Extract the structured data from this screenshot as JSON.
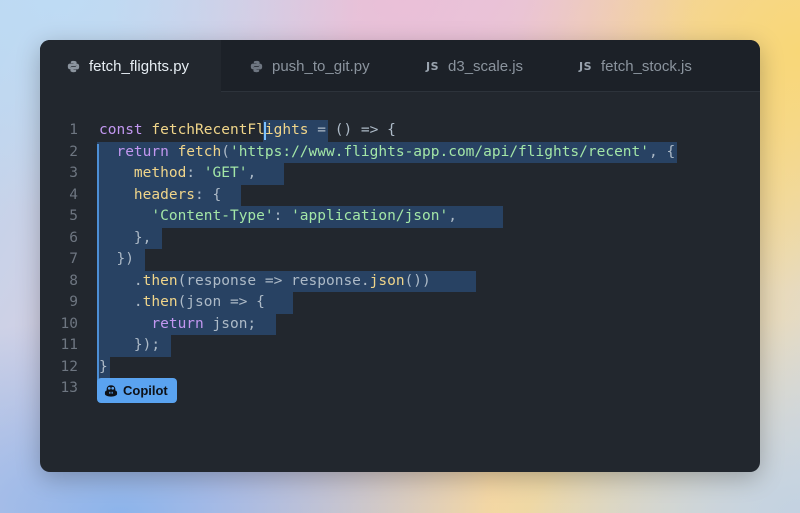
{
  "tabs": [
    {
      "label": "fetch_flights.py",
      "icon": "python-icon",
      "active": true
    },
    {
      "label": "push_to_git.py",
      "icon": "python-icon",
      "active": false
    },
    {
      "label": "d3_scale.js",
      "icon": "js-icon",
      "icon_text": "JS",
      "active": false
    },
    {
      "label": "fetch_stock.js",
      "icon": "js-icon",
      "icon_text": "JS",
      "active": false
    }
  ],
  "editor": {
    "line_numbers": [
      "1",
      "2",
      "3",
      "4",
      "5",
      "6",
      "7",
      "8",
      "9",
      "10",
      "11",
      "12",
      "13"
    ],
    "lines": [
      [
        {
          "t": "const ",
          "c": "k"
        },
        {
          "t": "fetchRecentFlights",
          "c": "f"
        },
        {
          "t": " = ",
          "c": "p"
        },
        {
          "t": "() => {",
          "c": "p"
        }
      ],
      [
        {
          "t": "  return ",
          "c": "k"
        },
        {
          "t": "fetch",
          "c": "f"
        },
        {
          "t": "(",
          "c": "p"
        },
        {
          "t": "'https://www.flights-app.com/api/flights/recent'",
          "c": "s"
        },
        {
          "t": ", {",
          "c": "p"
        }
      ],
      [
        {
          "t": "    method",
          "c": "pr"
        },
        {
          "t": ": ",
          "c": "p"
        },
        {
          "t": "'GET'",
          "c": "s"
        },
        {
          "t": ",",
          "c": "p"
        }
      ],
      [
        {
          "t": "    headers",
          "c": "pr"
        },
        {
          "t": ": {",
          "c": "p"
        }
      ],
      [
        {
          "t": "      ",
          "c": "p"
        },
        {
          "t": "'Content-Type'",
          "c": "s"
        },
        {
          "t": ": ",
          "c": "p"
        },
        {
          "t": "'application/json'",
          "c": "s"
        },
        {
          "t": ",",
          "c": "p"
        }
      ],
      [
        {
          "t": "    },",
          "c": "p"
        }
      ],
      [
        {
          "t": "  })",
          "c": "p"
        }
      ],
      [
        {
          "t": "    .",
          "c": "p"
        },
        {
          "t": "then",
          "c": "f"
        },
        {
          "t": "(response => response.",
          "c": "p"
        },
        {
          "t": "json",
          "c": "f"
        },
        {
          "t": "())",
          "c": "p"
        }
      ],
      [
        {
          "t": "    .",
          "c": "p"
        },
        {
          "t": "then",
          "c": "f"
        },
        {
          "t": "(json => {",
          "c": "p"
        }
      ],
      [
        {
          "t": "      return ",
          "c": "k"
        },
        {
          "t": "json;",
          "c": "p"
        }
      ],
      [
        {
          "t": "    });",
          "c": "p"
        }
      ],
      [
        {
          "t": "}",
          "c": "p"
        }
      ],
      []
    ],
    "highlights": [
      {
        "line": 0,
        "from": 19,
        "to": 26
      },
      {
        "line": 1,
        "from": 0,
        "to": 66
      },
      {
        "line": 2,
        "from": 0,
        "to": 21
      },
      {
        "line": 3,
        "from": 0,
        "to": 16
      },
      {
        "line": 4,
        "from": 0,
        "to": 46
      },
      {
        "line": 5,
        "from": 0,
        "to": 7
      },
      {
        "line": 6,
        "from": 0,
        "to": 5
      },
      {
        "line": 7,
        "from": 0,
        "to": 43
      },
      {
        "line": 8,
        "from": 0,
        "to": 22
      },
      {
        "line": 9,
        "from": 0,
        "to": 20
      },
      {
        "line": 10,
        "from": 0,
        "to": 8
      },
      {
        "line": 11,
        "from": 0,
        "to": 1
      }
    ],
    "caret": {
      "line": 0,
      "col": 19
    }
  },
  "copilot": {
    "label": "Copilot",
    "icon": "copilot-icon"
  },
  "colors": {
    "background_window": "#22272e",
    "tabbar": "#1c2128",
    "selection": "#284263",
    "keyword": "#c297f0",
    "function": "#f0d58a",
    "string": "#a3e6a7",
    "copilot_badge": "#5aa3f0"
  }
}
